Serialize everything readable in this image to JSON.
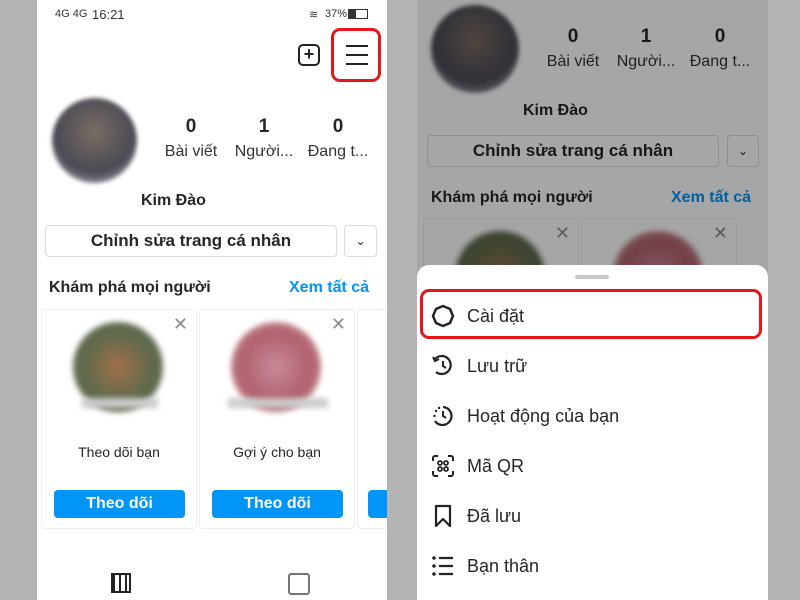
{
  "status": {
    "signal": "4G 4G",
    "time": "16:21",
    "battery": "37%"
  },
  "profile": {
    "name": "Kim Đào",
    "stats": [
      {
        "value": "0",
        "label": "Bài viết"
      },
      {
        "value": "1",
        "label": "Người..."
      },
      {
        "value": "0",
        "label": "Đang t..."
      }
    ],
    "edit_label": "Chỉnh sửa trang cá nhân"
  },
  "discover": {
    "title": "Khám phá mọi người",
    "see_all": "Xem tất cả",
    "cards": [
      {
        "subtitle": "Theo dõi bạn",
        "button": "Theo dõi"
      },
      {
        "subtitle": "Gợi ý cho bạn",
        "button": "Theo dõi"
      }
    ]
  },
  "menu": {
    "items": [
      {
        "label": "Cài đặt",
        "icon": "settings-icon"
      },
      {
        "label": "Lưu trữ",
        "icon": "archive-icon"
      },
      {
        "label": "Hoạt động của bạn",
        "icon": "activity-icon"
      },
      {
        "label": "Mã QR",
        "icon": "qr-icon"
      },
      {
        "label": "Đã lưu",
        "icon": "bookmark-icon"
      },
      {
        "label": "Bạn thân",
        "icon": "close-friends-icon"
      }
    ]
  },
  "colors": {
    "accent": "#0095f6",
    "highlight": "#e8141c"
  }
}
